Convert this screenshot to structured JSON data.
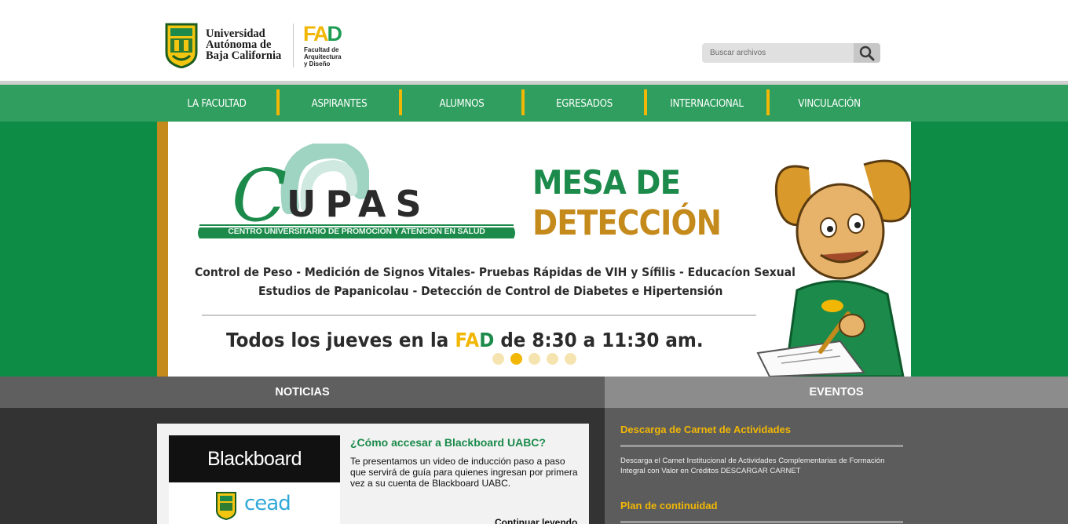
{
  "header": {
    "university_line1": "Universidad",
    "university_line2": "Autónoma de",
    "university_line3": "Baja California",
    "fad_f": "F",
    "fad_a": "A",
    "fad_d": "D",
    "fad_sub1": "Facultad de",
    "fad_sub2": "Arquitectura",
    "fad_sub3": "y Diseño",
    "search_placeholder": "Buscar archivos",
    "search_icon": "magnifier-icon"
  },
  "nav": {
    "items": [
      {
        "label": "LA FACULTAD"
      },
      {
        "label": "ASPIRANTES"
      },
      {
        "label": "ALUMNOS"
      },
      {
        "label": "EGRESADOS"
      },
      {
        "label": "INTERNACIONAL"
      },
      {
        "label": "VINCULACIÓN"
      }
    ]
  },
  "slide": {
    "cupas_initial": "C",
    "cupas_word": "UPAS",
    "cupas_tagline": "CENTRO UNIVERSITARIO DE PROMOCIÓN Y ATENCIÓN EN SALUD",
    "headline1": "MESA DE",
    "headline2": "DETECCIÓN",
    "services_line1": "Control de Peso - Medición de Signos Vitales- Pruebas Rápidas de VIH y Sífilis - Educacíon Sexual",
    "services_line2": "Estudios de Papanicolau - Detección de Control de Diabetes e Hipertensión",
    "schedule_pre": "Todos los jueves en la ",
    "schedule_f": "F",
    "schedule_a": "A",
    "schedule_d": "D",
    "schedule_post": " de 8:30 a 11:30 am.",
    "active_dot": 2,
    "dot_count": 5
  },
  "news": {
    "heading": "NOTICIAS",
    "thumb_brand": "Blackboard",
    "thumb_cead": "cead",
    "title": "¿Cómo accesar a Blackboard UABC?",
    "text": "Te presentamos un video de inducción paso a paso que servirá de guía para quienes ingresan por primera vez a su cuenta de Blackboard UABC.",
    "more": "Continuar leyendo"
  },
  "events": {
    "heading": "EVENTOS",
    "items": [
      {
        "title": "Descarga de Carnet de Actividades",
        "text": "Descarga el Carnet Institucional de Actividades Complementarias de Formación Integral con Valor en Créditos DESCARGAR CARNET"
      },
      {
        "title": "Plan de continuidad",
        "text": ""
      }
    ]
  },
  "colors": {
    "green": "#2f9e5e",
    "dark_green": "#0d8c46",
    "gold": "#f2b705",
    "ochre": "#c58a1c"
  }
}
